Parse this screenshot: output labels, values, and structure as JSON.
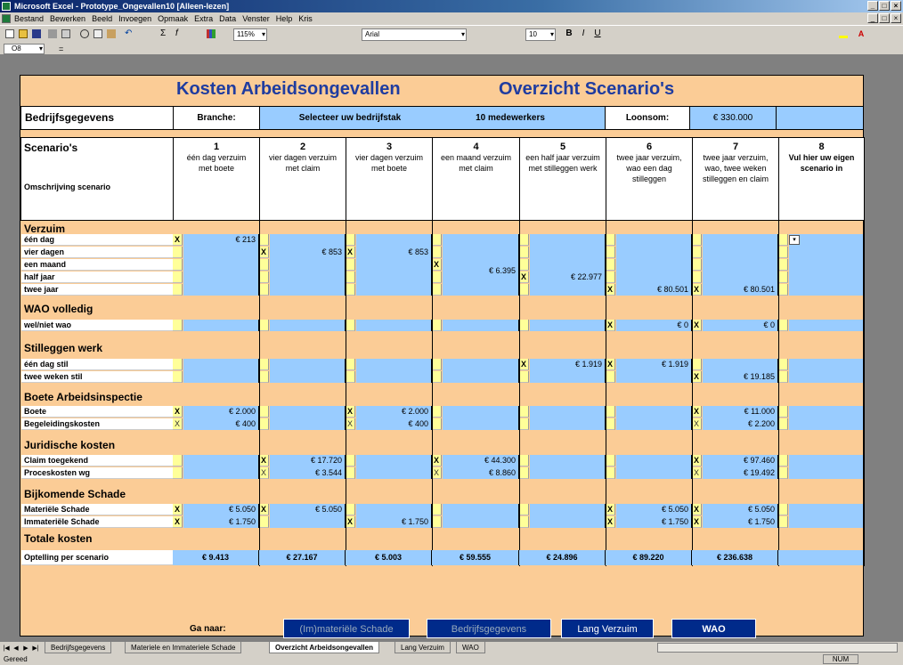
{
  "window": {
    "title": "Microsoft Excel - Prototype_Ongevallen10  [Alleen-lezen]"
  },
  "menu": [
    "Bestand",
    "Bewerken",
    "Beeld",
    "Invoegen",
    "Opmaak",
    "Extra",
    "Data",
    "Venster",
    "Help",
    "Kris"
  ],
  "toolbar": {
    "zoom": "115%",
    "font": "Arial",
    "size": "10"
  },
  "formula": {
    "cell": "O8",
    "fx": "="
  },
  "sheet": {
    "title1": "Kosten Arbeidsongevallen",
    "title2": "Overzicht Scenario's",
    "company": {
      "label": "Bedrijfsgegevens",
      "branche_label": "Branche:",
      "branche_value": "Selecteer uw bedrijfstak",
      "employees": "10 medewerkers",
      "loonsom_label": "Loonsom:",
      "loonsom_value": "€ 330.000"
    },
    "scen_label": "Scenario's",
    "desc_label": "Omschrijving scenario",
    "scenarios": [
      {
        "num": "1",
        "desc": "één dag verzuim met boete"
      },
      {
        "num": "2",
        "desc": "vier dagen verzuim met claim"
      },
      {
        "num": "3",
        "desc": "vier dagen verzuim met boete"
      },
      {
        "num": "4",
        "desc": "een maand verzuim met claim"
      },
      {
        "num": "5",
        "desc": "een half jaar verzuim met stilleggen werk"
      },
      {
        "num": "6",
        "desc": "twee jaar verzuim, wao een dag stilleggen"
      },
      {
        "num": "7",
        "desc": "twee jaar verzuim, wao, twee weken stilleggen en claim"
      },
      {
        "num": "8",
        "desc": "Vul hier uw eigen scenario in"
      }
    ],
    "sections": {
      "verzuim": "Verzuim",
      "wao": "WAO volledig",
      "stil": "Stilleggen werk",
      "boete": "Boete Arbeidsinspectie",
      "jur": "Juridische kosten",
      "schade": "Bijkomende Schade",
      "totaal": "Totale kosten"
    },
    "rows": {
      "dag": "één dag",
      "vier": "vier dagen",
      "maand": "een maand",
      "half": "half jaar",
      "twee": "twee jaar",
      "wao": "wel/niet wao",
      "stil1": "één dag stil",
      "stil2": "twee weken stil",
      "boete": "Boete",
      "begel": "Begeleidingskosten",
      "claim": "Claim toegekend",
      "proces": "Proceskosten wg",
      "mat": "Materiële Schade",
      "immat": "Immateriële Schade",
      "optel": "Optelling per scenario"
    },
    "values": {
      "v1_dag": "€ 213",
      "v2_vier": "€ 853",
      "v3_vier": "€ 853",
      "v4_maand": "€ 6.395",
      "v5_half": "€ 22.977",
      "v6_twee": "€ 80.501",
      "v7_twee": "€ 80.501",
      "v6_wao": "€ 0",
      "v7_wao": "€ 0",
      "v5_stil": "€ 1.919",
      "v6_stil": "€ 1.919",
      "v7_stil": "€ 19.185",
      "v1_boete": "€ 2.000",
      "v1_begel": "€ 400",
      "v3_boete": "€ 2.000",
      "v3_begel": "€ 400",
      "v7_boete": "€ 11.000",
      "v7_begel": "€ 2.200",
      "v2_claim": "€ 17.720",
      "v2_proces": "€ 3.544",
      "v4_claim": "€ 44.300",
      "v4_proces": "€ 8.860",
      "v7_claim": "€ 97.460",
      "v7_proces": "€ 19.492",
      "v1_mat": "€ 5.050",
      "v2_mat": "€ 5.050",
      "v6_mat": "€ 5.050",
      "v7_mat": "€ 5.050",
      "v1_imm": "€ 1.750",
      "v3_imm": "€ 1.750",
      "v6_imm": "€ 1.750",
      "v7_imm": "€ 1.750"
    },
    "x": "X",
    "totals": [
      "€ 9.413",
      "€ 27.167",
      "€ 5.003",
      "€ 59.555",
      "€ 24.896",
      "€ 89.220",
      "€ 236.638",
      ""
    ],
    "nav": {
      "label": "Ga naar:",
      "b1": "(Im)materiële Schade",
      "b2": "Bedrijfsgegevens",
      "b3": "Lang Verzuim",
      "b4": "WAO"
    }
  },
  "tabs": [
    "Bedrijfsgegevens",
    "Materiele en Immateriele Schade",
    "Overzicht Arbeidsongevallen",
    "Lang Verzuim",
    "WAO"
  ],
  "status": {
    "left": "Gereed",
    "num": "NUM"
  },
  "colors": {
    "peach": "#fbcc96",
    "blue": "#99ccff",
    "yellow": "#ffff99",
    "title": "#1f3ca0",
    "button": "#002a8a"
  }
}
